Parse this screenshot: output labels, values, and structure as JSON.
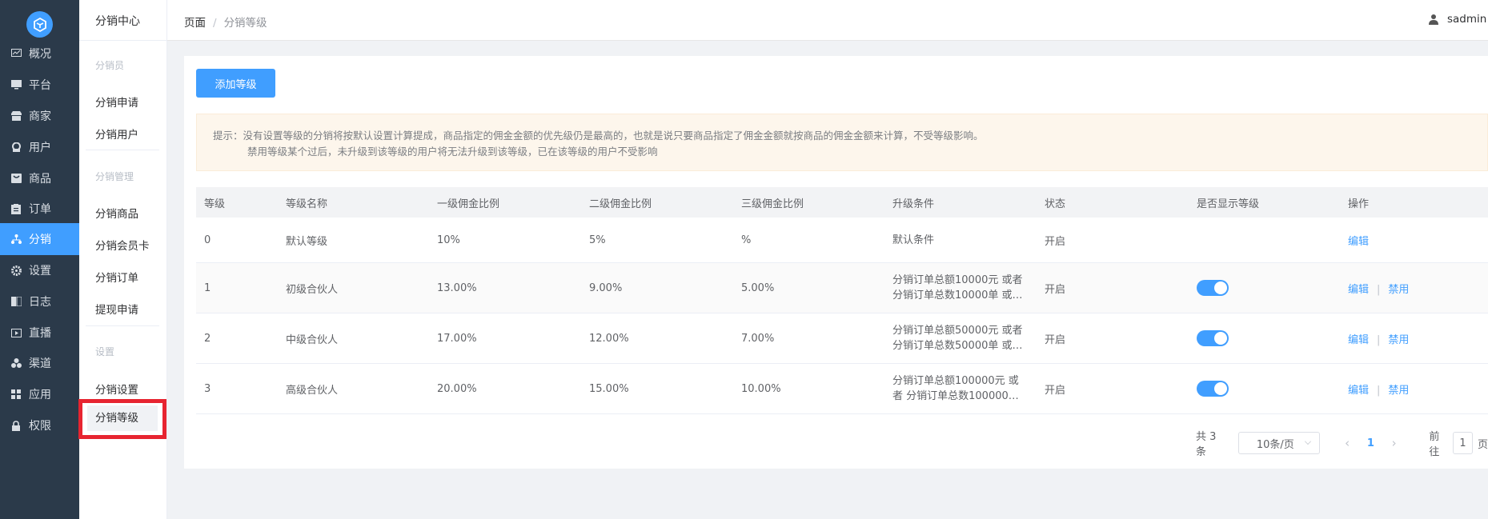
{
  "nav": {
    "items": [
      {
        "label": "概况",
        "icon": "chart-icon"
      },
      {
        "label": "平台",
        "icon": "monitor-icon"
      },
      {
        "label": "商家",
        "icon": "store-icon"
      },
      {
        "label": "用户",
        "icon": "user-icon"
      },
      {
        "label": "商品",
        "icon": "goods-icon"
      },
      {
        "label": "订单",
        "icon": "order-icon"
      },
      {
        "label": "分销",
        "icon": "distribution-icon"
      },
      {
        "label": "设置",
        "icon": "gear-icon"
      },
      {
        "label": "日志",
        "icon": "log-icon"
      },
      {
        "label": "直播",
        "icon": "live-icon"
      },
      {
        "label": "渠道",
        "icon": "channel-icon"
      },
      {
        "label": "应用",
        "icon": "apps-icon"
      },
      {
        "label": "权限",
        "icon": "lock-icon"
      }
    ],
    "active_index": 6
  },
  "submenu": {
    "title": "分销中心",
    "group1": "分销员",
    "apply": "分销申请",
    "users": "分销用户",
    "group2": "分销管理",
    "goods": "分销商品",
    "card": "分销会员卡",
    "orders": "分销订单",
    "withdraw": "提现申请",
    "group3": "设置",
    "settings": "分销设置",
    "levels": "分销等级"
  },
  "header": {
    "breadcrumb_root": "页面",
    "breadcrumb_sep": "/",
    "breadcrumb_current": "分销等级",
    "username": "sadmin"
  },
  "toolbar": {
    "add_label": "添加等级"
  },
  "tip": {
    "line1": "提示：没有设置等级的分销将按默认设置计算提成，商品指定的佣金金额的优先级仍是最高的，也就是说只要商品指定了佣金金额就按商品的佣金金额来计算，不受等级影响。",
    "line2": "禁用等级某个过后，未升级到该等级的用户将无法升级到该等级，已在该等级的用户不受影响"
  },
  "table": {
    "headers": [
      "等级",
      "等级名称",
      "一级佣金比例",
      "二级佣金比例",
      "三级佣金比例",
      "升级条件",
      "状态",
      "是否显示等级",
      "操作"
    ],
    "rows": [
      {
        "level": "0",
        "name": "默认等级",
        "r1": "10%",
        "r2": "5%",
        "r3": "%",
        "cond1": "默认条件",
        "cond2": "",
        "status": "开启",
        "show": false,
        "edit": "编辑",
        "disable": ""
      },
      {
        "level": "1",
        "name": "初级合伙人",
        "r1": "13.00%",
        "r2": "9.00%",
        "r3": "5.00%",
        "cond1": "分销订单总额10000元 或者",
        "cond2": "分销订单总数10000单 或…",
        "status": "开启",
        "show": true,
        "edit": "编辑",
        "disable": "禁用"
      },
      {
        "level": "2",
        "name": "中级合伙人",
        "r1": "17.00%",
        "r2": "12.00%",
        "r3": "7.00%",
        "cond1": "分销订单总额50000元 或者",
        "cond2": "分销订单总数50000单 或…",
        "status": "开启",
        "show": true,
        "edit": "编辑",
        "disable": "禁用"
      },
      {
        "level": "3",
        "name": "高级合伙人",
        "r1": "20.00%",
        "r2": "15.00%",
        "r3": "10.00%",
        "cond1": "分销订单总额100000元 或",
        "cond2": "者 分销订单总数100000…",
        "status": "开启",
        "show": true,
        "edit": "编辑",
        "disable": "禁用"
      }
    ]
  },
  "pager": {
    "total": "共 3 条",
    "page_size": "10条/页",
    "prev": "‹",
    "current": "1",
    "next": "›",
    "goto_label": "前往",
    "goto_value": "1",
    "page_suffix": "页"
  },
  "colors": {
    "accent": "#409eff",
    "nav_bg": "#2b3a4a",
    "highlight": "#e72430"
  }
}
